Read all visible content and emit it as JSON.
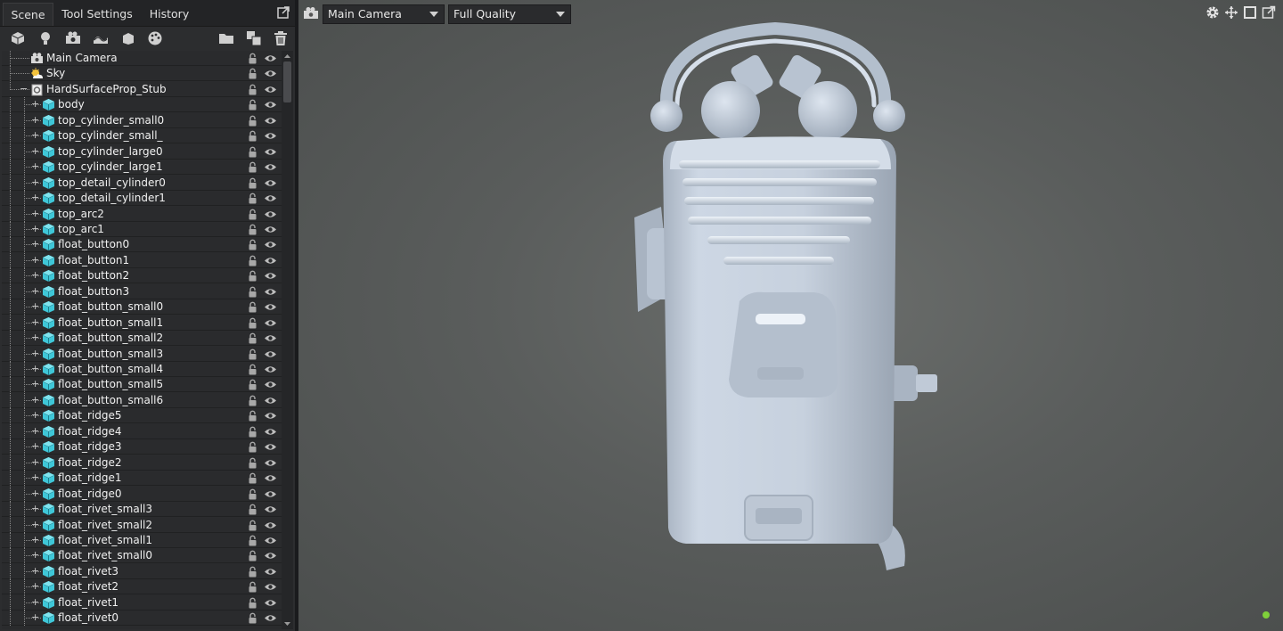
{
  "tabs": [
    {
      "label": "Scene",
      "active": true
    },
    {
      "label": "Tool Settings",
      "active": false
    },
    {
      "label": "History",
      "active": false
    }
  ],
  "toolbar_icons": [
    "cube-icon",
    "lightbulb-icon",
    "camera-icon",
    "terrain-icon",
    "material-box-icon",
    "palette-icon",
    "folder-icon",
    "duplicate-icon",
    "trash-icon"
  ],
  "scene_tree": [
    {
      "label": "Main Camera",
      "icon": "camera",
      "level": 0
    },
    {
      "label": "Sky",
      "icon": "sky",
      "level": 0
    },
    {
      "label": "HardSurfaceProp_Stub",
      "icon": "prefab",
      "level": 0,
      "expanded": true
    },
    {
      "label": "body",
      "icon": "mesh",
      "level": 1
    },
    {
      "label": "top_cylinder_small0",
      "icon": "mesh",
      "level": 1
    },
    {
      "label": "top_cylinder_small_",
      "icon": "mesh",
      "level": 1
    },
    {
      "label": "top_cylinder_large0",
      "icon": "mesh",
      "level": 1
    },
    {
      "label": "top_cylinder_large1",
      "icon": "mesh",
      "level": 1
    },
    {
      "label": "top_detail_cylinder0",
      "icon": "mesh",
      "level": 1
    },
    {
      "label": "top_detail_cylinder1",
      "icon": "mesh",
      "level": 1
    },
    {
      "label": "top_arc2",
      "icon": "mesh",
      "level": 1
    },
    {
      "label": "top_arc1",
      "icon": "mesh",
      "level": 1
    },
    {
      "label": "float_button0",
      "icon": "mesh",
      "level": 1
    },
    {
      "label": "float_button1",
      "icon": "mesh",
      "level": 1
    },
    {
      "label": "float_button2",
      "icon": "mesh",
      "level": 1
    },
    {
      "label": "float_button3",
      "icon": "mesh",
      "level": 1
    },
    {
      "label": "float_button_small0",
      "icon": "mesh",
      "level": 1
    },
    {
      "label": "float_button_small1",
      "icon": "mesh",
      "level": 1
    },
    {
      "label": "float_button_small2",
      "icon": "mesh",
      "level": 1
    },
    {
      "label": "float_button_small3",
      "icon": "mesh",
      "level": 1
    },
    {
      "label": "float_button_small4",
      "icon": "mesh",
      "level": 1
    },
    {
      "label": "float_button_small5",
      "icon": "mesh",
      "level": 1
    },
    {
      "label": "float_button_small6",
      "icon": "mesh",
      "level": 1
    },
    {
      "label": "float_ridge5",
      "icon": "mesh",
      "level": 1
    },
    {
      "label": "float_ridge4",
      "icon": "mesh",
      "level": 1
    },
    {
      "label": "float_ridge3",
      "icon": "mesh",
      "level": 1
    },
    {
      "label": "float_ridge2",
      "icon": "mesh",
      "level": 1
    },
    {
      "label": "float_ridge1",
      "icon": "mesh",
      "level": 1
    },
    {
      "label": "float_ridge0",
      "icon": "mesh",
      "level": 1
    },
    {
      "label": "float_rivet_small3",
      "icon": "mesh",
      "level": 1
    },
    {
      "label": "float_rivet_small2",
      "icon": "mesh",
      "level": 1
    },
    {
      "label": "float_rivet_small1",
      "icon": "mesh",
      "level": 1
    },
    {
      "label": "float_rivet_small0",
      "icon": "mesh",
      "level": 1
    },
    {
      "label": "float_rivet3",
      "icon": "mesh",
      "level": 1
    },
    {
      "label": "float_rivet2",
      "icon": "mesh",
      "level": 1
    },
    {
      "label": "float_rivet1",
      "icon": "mesh",
      "level": 1
    },
    {
      "label": "float_rivet0",
      "icon": "mesh",
      "level": 1
    }
  ],
  "viewport": {
    "camera_select": "Main Camera",
    "quality_select": "Full Quality",
    "controls": [
      "gear-icon",
      "move-icon",
      "maximize-icon",
      "popout-icon"
    ],
    "status_color": "#7fd03a",
    "model_color": "#c9d3e0"
  },
  "colors": {
    "panel_bg": "#2c2d2f",
    "mesh_icon": "#3fc7d8",
    "viewport_bg": "#5f6261"
  }
}
